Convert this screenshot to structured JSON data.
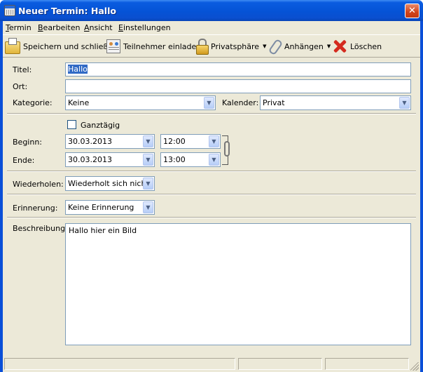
{
  "window": {
    "title": "Neuer Termin: Hallo",
    "close_glyph": "✕"
  },
  "menu": {
    "items": [
      "Termin",
      "Bearbeiten",
      "Ansicht",
      "Einstellungen"
    ]
  },
  "toolbar": {
    "save": "Speichern und schließen",
    "invite": "Teilnehmer einladen",
    "privacy": "Privatsphäre",
    "attach": "Anhängen",
    "delete": "Löschen",
    "dropdown_arrow": "▼"
  },
  "form": {
    "title_label": "Titel:",
    "title_value": "Hallo",
    "location_label": "Ort:",
    "location_value": "",
    "category_label": "Kategorie:",
    "category_value": "Keine",
    "calendar_label": "Kalender:",
    "calendar_value": "Privat",
    "allday_label": "Ganztägig",
    "allday_checked": false,
    "start_label": "Beginn:",
    "start_date": "30.03.2013",
    "start_time": "12:00",
    "end_label": "Ende:",
    "end_date": "30.03.2013",
    "end_time": "13:00",
    "repeat_label": "Wiederholen:",
    "repeat_value": "Wiederholt sich nicht",
    "reminder_label": "Erinnerung:",
    "reminder_value": "Keine Erinnerung",
    "description_label": "Beschreibung:",
    "description_value": "Hallo hier ein Bild"
  },
  "icons": {
    "save": "save-icon",
    "invite": "invite-attendees-icon",
    "privacy": "lock-icon",
    "attach": "paperclip-icon",
    "delete": "delete-x-icon",
    "link": "chain-link-icon"
  },
  "colors": {
    "titlebar": "#0553d6",
    "client_bg": "#ece9d8",
    "selection": "#316ac5",
    "close_button": "#d2431a",
    "field_border": "#7f9db9"
  }
}
